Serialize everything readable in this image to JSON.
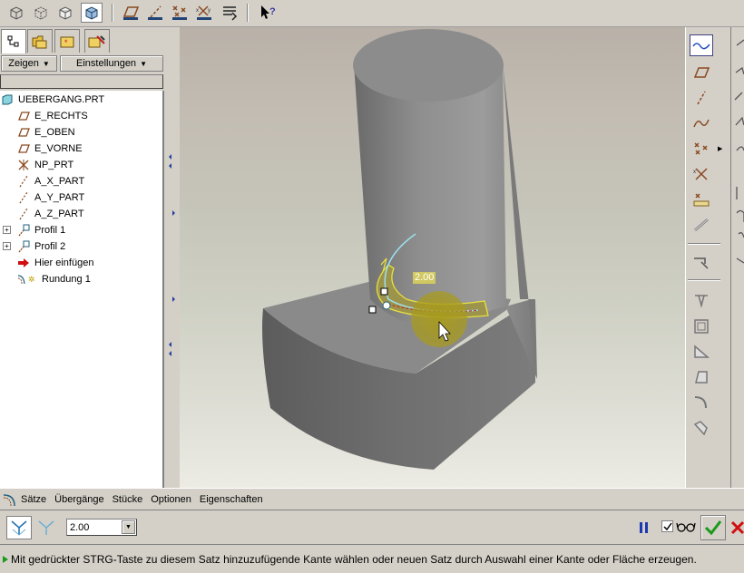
{
  "toolbar": {
    "icons": [
      "wireframe-icon",
      "hidden-line-icon",
      "no-hidden-icon",
      "shading-icon",
      "datum-planes-icon",
      "datum-axes-icon",
      "datum-points-icon",
      "coordinate-systems-icon",
      "spin-center-icon",
      "context-help-icon"
    ]
  },
  "left_panel": {
    "tabs": [
      "model-tree-tab",
      "folder-browser-tab",
      "favorites-tab",
      "connections-tab"
    ],
    "show_menu": "Zeigen",
    "settings_menu": "Einstellungen",
    "tree": [
      {
        "label": "UEBERGANG.PRT",
        "icon": "part-icon"
      },
      {
        "label": "E_RECHTS",
        "icon": "datum-plane-icon"
      },
      {
        "label": "E_OBEN",
        "icon": "datum-plane-icon"
      },
      {
        "label": "E_VORNE",
        "icon": "datum-plane-icon"
      },
      {
        "label": "NP_PRT",
        "icon": "coordinate-system-icon"
      },
      {
        "label": "A_X_PART",
        "icon": "datum-axis-icon"
      },
      {
        "label": "A_Y_PART",
        "icon": "datum-axis-icon"
      },
      {
        "label": "A_Z_PART",
        "icon": "datum-axis-icon"
      },
      {
        "label": "Profil 1",
        "icon": "sketch-icon"
      },
      {
        "label": "Profil 2",
        "icon": "sketch-icon"
      },
      {
        "label": "Hier einfügen",
        "icon": "insert-here-arrow-icon"
      },
      {
        "label": "Rundung 1",
        "icon": "round-icon"
      }
    ]
  },
  "viewport": {
    "dimension_label": "2.00"
  },
  "dashboard": {
    "tabs": [
      "Sätze",
      "Übergänge",
      "Stücke",
      "Optionen",
      "Eigenschaften"
    ],
    "radius_value": "2.00"
  },
  "status": {
    "message": "Mit gedrückter STRG-Taste zu diesem Satz hinzuzufügende Kante wählen oder neuen Satz durch Auswahl einer Kante oder Fläche erzeugen."
  },
  "colors": {
    "window_bg": "#d4d0c8",
    "model_gray": "#8c8c8c",
    "highlight_yellow": "#e8e040",
    "confirm_green": "#1a9a1a",
    "cancel_red": "#d01010"
  }
}
